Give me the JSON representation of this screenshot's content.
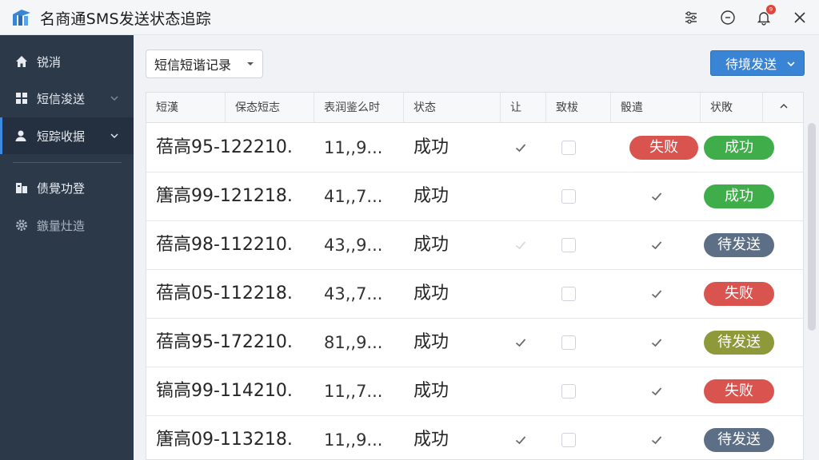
{
  "app": {
    "title": "名商通SMS发送状态追踪",
    "notification_count": "9"
  },
  "sidebar": {
    "items": [
      {
        "label": "锐消",
        "icon": "home-icon"
      },
      {
        "label": "短信浚送",
        "icon": "grid-icon"
      },
      {
        "label": "短踪收据",
        "icon": "user-icon"
      },
      {
        "label": "债覺功登",
        "icon": "report-icon"
      },
      {
        "label": "鏃量灶造",
        "icon": "gear-icon"
      }
    ]
  },
  "toolbar": {
    "dropdown_label": "短信短谐记录",
    "primary_label": "待境发送"
  },
  "table": {
    "headers": [
      "短漢",
      "保态短志",
      "表润鉴么时",
      "状态",
      "让",
      "致柭",
      "骰遣",
      "状敗"
    ],
    "rows": [
      {
        "id": "蓓高95-122210.",
        "time": "11,,9...",
        "status": "成功",
        "c1": "check",
        "c2": "box",
        "c3": "none",
        "pill_a": "失败",
        "pill_b": "成功",
        "pill_b_type": "success"
      },
      {
        "id": "篖高99-121218.",
        "time": "41,,7...",
        "status": "成功",
        "c1": "none",
        "c2": "box",
        "c3": "check",
        "pill_a": "",
        "pill_b": "成功",
        "pill_b_type": "success"
      },
      {
        "id": "蓓高98-112210.",
        "time": "43,,9...",
        "status": "成功",
        "c1": "faint",
        "c2": "box",
        "c3": "check",
        "pill_a": "",
        "pill_b": "待发送",
        "pill_b_type": "pending"
      },
      {
        "id": "蓓高05-112218.",
        "time": "43,,7...",
        "status": "成功",
        "c1": "none",
        "c2": "box",
        "c3": "check",
        "pill_a": "",
        "pill_b": "失败",
        "pill_b_type": "fail"
      },
      {
        "id": "蓓高95-172210.",
        "time": "81,,9...",
        "status": "成功",
        "c1": "check",
        "c2": "box",
        "c3": "check",
        "pill_a": "",
        "pill_b": "待发送",
        "pill_b_type": "olive"
      },
      {
        "id": "镐高99-114210.",
        "time": "11,,7...",
        "status": "成功",
        "c1": "none",
        "c2": "box",
        "c3": "check",
        "pill_a": "",
        "pill_b": "失败",
        "pill_b_type": "fail"
      },
      {
        "id": "篖高09-113218.",
        "time": "11,,9...",
        "status": "成功",
        "c1": "check",
        "c2": "box",
        "c3": "check",
        "pill_a": "",
        "pill_b": "待发送",
        "pill_b_type": "pending"
      }
    ]
  },
  "colors": {
    "success": "#3fae4a",
    "fail": "#d9534f",
    "pending": "#5d6f86",
    "olive": "#8e9a3a",
    "primary": "#3a84d6",
    "sidebar": "#2c3949"
  }
}
